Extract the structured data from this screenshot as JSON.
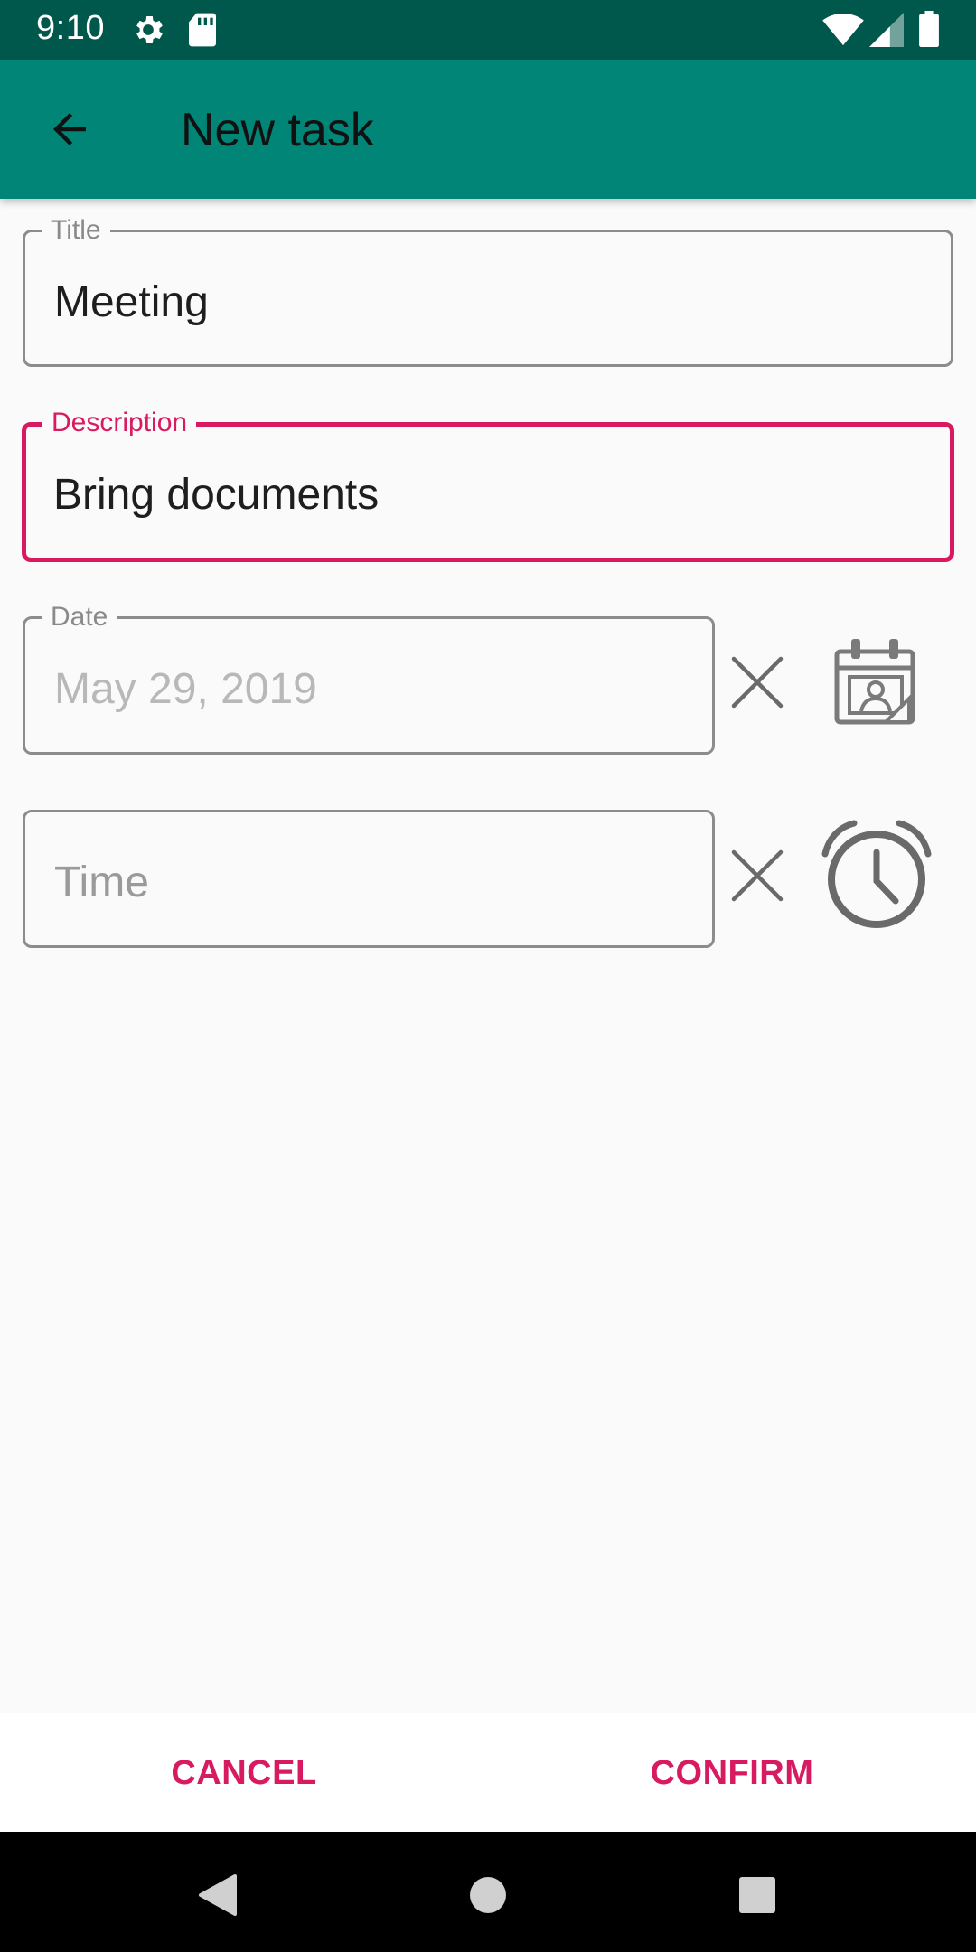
{
  "status_bar": {
    "time": "9:10",
    "icons": [
      "settings-icon",
      "sd-card-icon",
      "wifi-icon",
      "signal-icon",
      "battery-icon"
    ]
  },
  "app_bar": {
    "title": "New task",
    "back_icon": "arrow-back-icon",
    "background_color": "#008577"
  },
  "form": {
    "title": {
      "label": "Title",
      "value": "Meeting"
    },
    "description": {
      "label": "Description",
      "value": "Bring documents",
      "focused": true
    },
    "date": {
      "label": "Date",
      "value": "May 29, 2019",
      "clear_icon": "close-icon",
      "picker_icon": "calendar-icon"
    },
    "time": {
      "placeholder": "Time",
      "clear_icon": "close-icon",
      "picker_icon": "alarm-clock-icon"
    }
  },
  "actions": {
    "cancel_label": "CANCEL",
    "confirm_label": "CONFIRM",
    "accent_color": "#d81b60"
  },
  "nav_bar": {
    "icons": [
      "back-triangle-icon",
      "home-circle-icon",
      "recents-square-icon"
    ]
  }
}
